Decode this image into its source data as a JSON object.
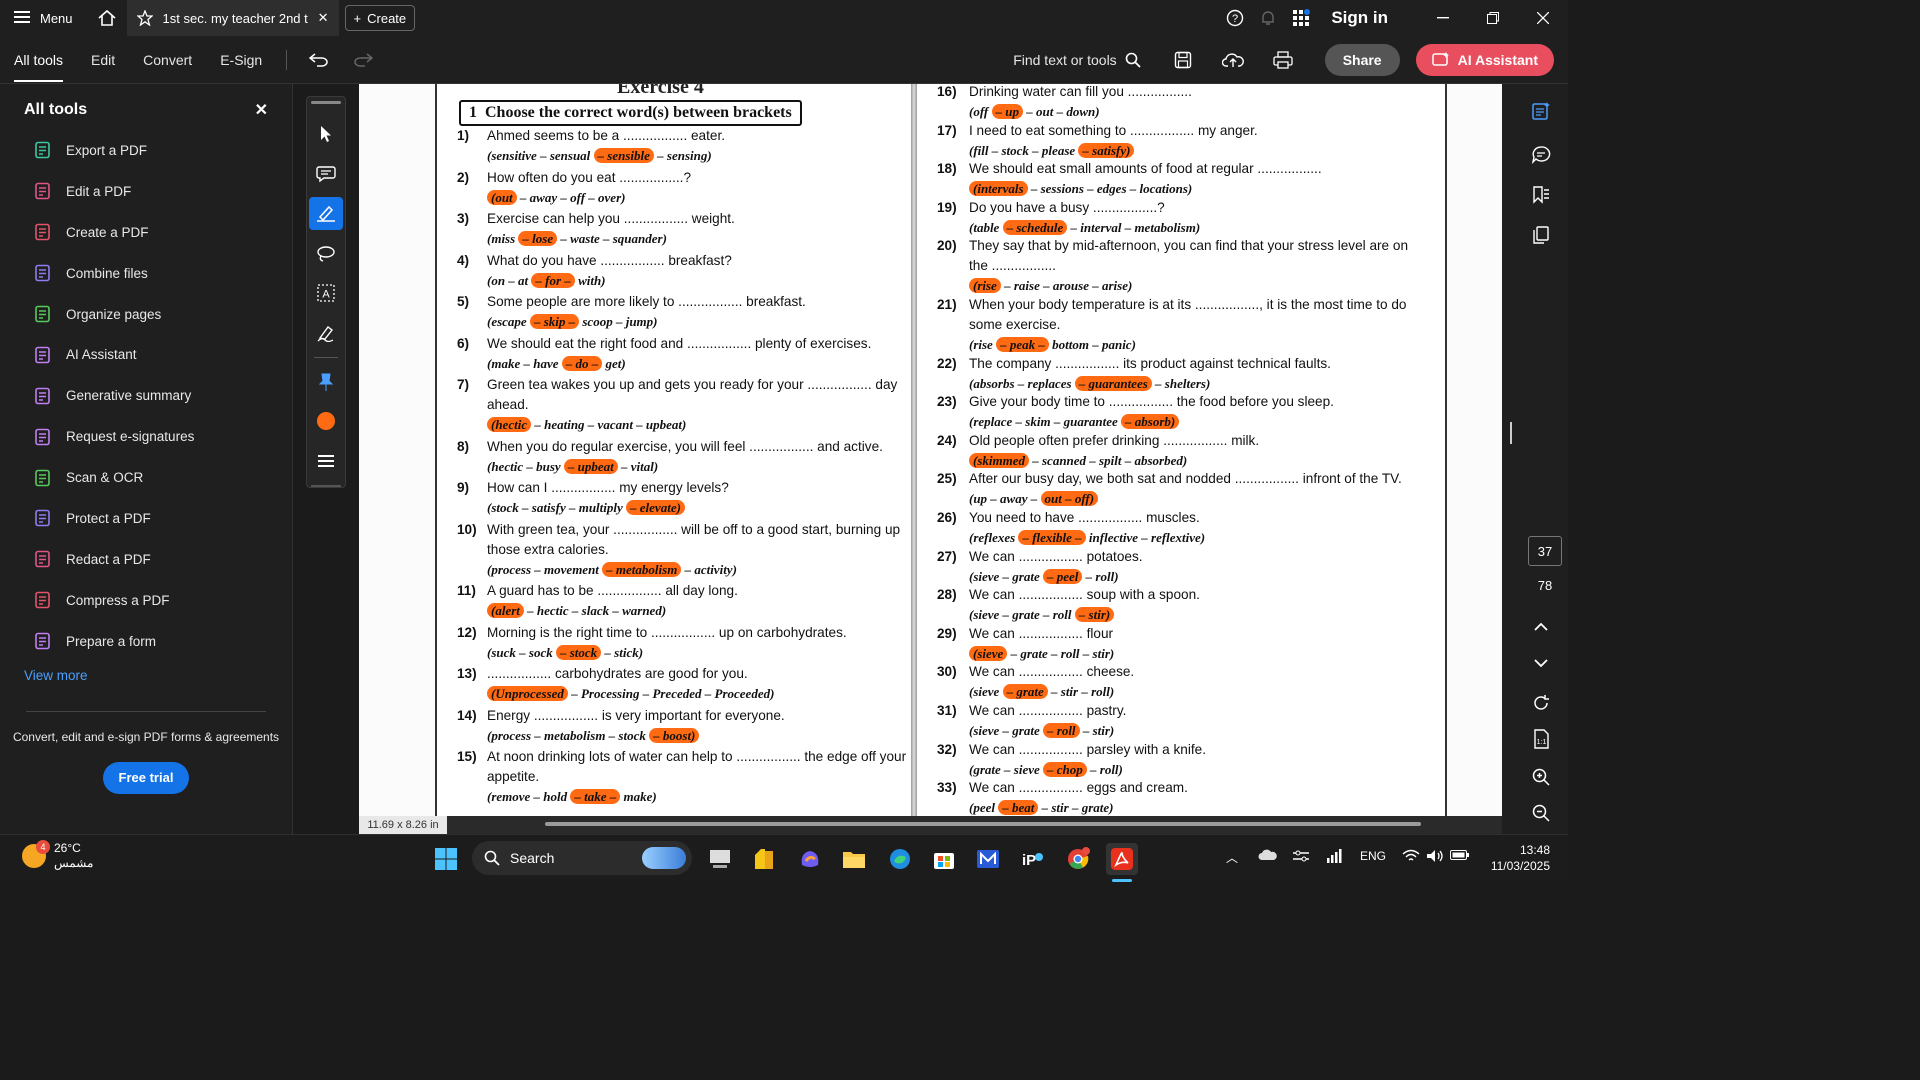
{
  "titlebar": {
    "menu_label": "Menu",
    "tab_title": "1st sec. my teacher 2nd t...",
    "create_label": "Create",
    "signin_label": "Sign in"
  },
  "toolbar": {
    "tabs": [
      "All tools",
      "Edit",
      "Convert",
      "E-Sign"
    ],
    "find_label": "Find text or tools",
    "share_label": "Share",
    "ai_label": "AI Assistant"
  },
  "leftpanel": {
    "title": "All tools",
    "items": [
      {
        "label": "Export a PDF",
        "icon": "export-pdf-icon",
        "color": "#3ac7a0"
      },
      {
        "label": "Edit a PDF",
        "icon": "edit-pdf-icon",
        "color": "#e0558a"
      },
      {
        "label": "Create a PDF",
        "icon": "create-pdf-icon",
        "color": "#e0556a"
      },
      {
        "label": "Combine files",
        "icon": "combine-files-icon",
        "color": "#8e7cf0"
      },
      {
        "label": "Organize pages",
        "icon": "organize-pages-icon",
        "color": "#57c95a"
      },
      {
        "label": "AI Assistant",
        "icon": "ai-assistant-icon",
        "color": "#c07ff0"
      },
      {
        "label": "Generative summary",
        "icon": "generative-summary-icon",
        "color": "#c07ff0"
      },
      {
        "label": "Request e-signatures",
        "icon": "request-esignatures-icon",
        "color": "#c07ff0"
      },
      {
        "label": "Scan & OCR",
        "icon": "scan-ocr-icon",
        "color": "#57c95a"
      },
      {
        "label": "Protect a PDF",
        "icon": "protect-pdf-icon",
        "color": "#8e7cf0"
      },
      {
        "label": "Redact a PDF",
        "icon": "redact-pdf-icon",
        "color": "#e0558a"
      },
      {
        "label": "Compress a PDF",
        "icon": "compress-pdf-icon",
        "color": "#e0556a"
      },
      {
        "label": "Prepare a form",
        "icon": "prepare-form-icon",
        "color": "#c07ff0"
      }
    ],
    "view_more": "View more",
    "footer_text": "Convert, edit and e-sign PDF forms & agreements",
    "free_trial": "Free trial"
  },
  "document": {
    "title_top": "Exercise 4",
    "exercise_heading": "Choose the correct word(s) between brackets",
    "heading_number": "1",
    "left_questions": [
      {
        "n": "1)",
        "q": "Ahmed seems to be a ................. eater.",
        "opts": [
          "(sensitive – sensual ",
          "– sensible",
          " – sensing)"
        ]
      },
      {
        "n": "2)",
        "q": "How often do you eat .................?",
        "opts": [
          "",
          "(out",
          " – away – off – over)"
        ]
      },
      {
        "n": "3)",
        "q": "Exercise can help you ................. weight.",
        "opts": [
          "(miss ",
          "– lose",
          " – waste – squander)"
        ]
      },
      {
        "n": "4)",
        "q": "What do you have ................. breakfast?",
        "opts": [
          "(on – at ",
          "– for –",
          " with)"
        ]
      },
      {
        "n": "5)",
        "q": "Some people are more likely to ................. breakfast.",
        "opts": [
          "(escape ",
          "– skip –",
          " scoop – jump)"
        ]
      },
      {
        "n": "6)",
        "q": "We should eat the right food and ................. plenty of exercises.",
        "opts": [
          "(make – have ",
          "– do –",
          " get)"
        ]
      },
      {
        "n": "7)",
        "q": "Green tea wakes you up and gets you ready for your ................. day",
        "q2": "ahead.",
        "opts": [
          "",
          "(hectic",
          " – heating – vacant – upbeat)"
        ]
      },
      {
        "n": "8)",
        "q": "When you do regular exercise, you will feel ................. and active.",
        "opts": [
          "(hectic – busy ",
          "– upbeat",
          " – vital)"
        ]
      },
      {
        "n": "9)",
        "q": "How can I ................. my energy levels?",
        "opts": [
          "(stock – satisfy – multiply ",
          "– elevate)",
          ""
        ]
      },
      {
        "n": "10)",
        "q": "With green tea, your ................. will be off to a good start, burning up",
        "q2": "those extra calories.",
        "opts": [
          "(process – movement ",
          "– metabolism",
          " – activity)"
        ]
      },
      {
        "n": "11)",
        "q": "A guard has to be ................. all day long.",
        "opts": [
          "",
          "(alert",
          " – hectic – slack – warned)"
        ]
      },
      {
        "n": "12)",
        "q": "Morning is the right time to ................. up on carbohydrates.",
        "opts": [
          "(suck – sock ",
          "– stock",
          " – stick)"
        ]
      },
      {
        "n": "13)",
        "q": "................. carbohydrates are good for you.",
        "opts": [
          "",
          "(Unprocessed",
          " – Processing – Preceded – Proceeded)"
        ]
      },
      {
        "n": "14)",
        "q": "Energy ................. is very important for everyone.",
        "opts": [
          "(process – metabolism – stock ",
          "– boost)",
          ""
        ]
      },
      {
        "n": "15)",
        "q": "At noon drinking lots of water can help to ................. the edge off your",
        "q2": "appetite.",
        "opts": [
          "(remove – hold ",
          "– take –",
          " make)"
        ]
      }
    ],
    "right_questions": [
      {
        "n": "16)",
        "q": "Drinking water can fill you .................",
        "opts": [
          "(off ",
          "– up",
          " – out – down)"
        ]
      },
      {
        "n": "17)",
        "q": "I need to eat something to ................. my anger.",
        "opts": [
          "(fill – stock – please ",
          "– satisfy)",
          ""
        ]
      },
      {
        "n": "18)",
        "q": "We should eat small amounts of food at regular .................",
        "opts": [
          "",
          "(intervals",
          " – sessions – edges – locations)"
        ]
      },
      {
        "n": "19)",
        "q": "Do you have a busy .................?",
        "opts": [
          "(table ",
          "– schedule",
          " – interval – metabolism)"
        ]
      },
      {
        "n": "20)",
        "q": "They say that by mid-afternoon, you can find that your stress level are on",
        "q2": "the .................",
        "opts": [
          "",
          "(rise",
          " – raise – arouse – arise)"
        ]
      },
      {
        "n": "21)",
        "q": "When your body temperature is at its ................., it is the most time to do",
        "q2": "some exercise.",
        "opts": [
          "(rise ",
          "– peak –",
          " bottom – panic)"
        ]
      },
      {
        "n": "22)",
        "q": "The company ................. its product against technical faults.",
        "opts": [
          "(absorbs – replaces ",
          "– guarantees",
          " – shelters)"
        ]
      },
      {
        "n": "23)",
        "q": "Give your body time to ................. the food before you sleep.",
        "opts": [
          "(replace – skim – guarantee ",
          "– absorb)",
          ""
        ]
      },
      {
        "n": "24)",
        "q": "Old people often prefer drinking ................. milk.",
        "opts": [
          "",
          "(skimmed",
          " – scanned – spilt – absorbed)"
        ]
      },
      {
        "n": "25)",
        "q": "After our busy day, we both sat and nodded ................. infront of the TV.",
        "opts": [
          "(up – away – ",
          "out – off)",
          ""
        ]
      },
      {
        "n": "26)",
        "q": "You need to have ................. muscles.",
        "opts": [
          "(reflexes ",
          "– flexible –",
          " inflective – reflextive)"
        ]
      },
      {
        "n": "27)",
        "q": "We can ................. potatoes.",
        "opts": [
          "(sieve – grate ",
          "– peel",
          " – roll)"
        ]
      },
      {
        "n": "28)",
        "q": "We can ................. soup with a spoon.",
        "opts": [
          "(sieve – grate – roll ",
          "– stir)",
          ""
        ]
      },
      {
        "n": "29)",
        "q": "We can ................. flour",
        "opts": [
          "",
          "(sieve",
          " – grate – roll – stir)"
        ]
      },
      {
        "n": "30)",
        "q": "We can ................. cheese.",
        "opts": [
          "(sieve ",
          "– grate",
          " – stir – roll)"
        ]
      },
      {
        "n": "31)",
        "q": "We can ................. pastry.",
        "opts": [
          "(sieve – grate ",
          "– roll",
          " – stir)"
        ]
      },
      {
        "n": "32)",
        "q": "We can ................. parsley with a knife.",
        "opts": [
          "(grate – sieve ",
          "– chop",
          " – roll)"
        ]
      },
      {
        "n": "33)",
        "q": "We can ................. eggs and cream.",
        "opts": [
          "(peel ",
          "– beat",
          " – stir – grate)"
        ]
      }
    ],
    "page_size": "11.69 x 8.26 in"
  },
  "rightrail": {
    "current_page": "37",
    "total_pages": "78"
  },
  "taskbar": {
    "temperature": "26°C",
    "weather_label": "مشمس",
    "search_label": "Search",
    "language": "ENG",
    "time": "13:48",
    "date": "11/03/2025"
  },
  "colors": {
    "highlight": "#ff6a13",
    "accent_blue": "#1473e6",
    "ai_button": "#e94e5f"
  }
}
